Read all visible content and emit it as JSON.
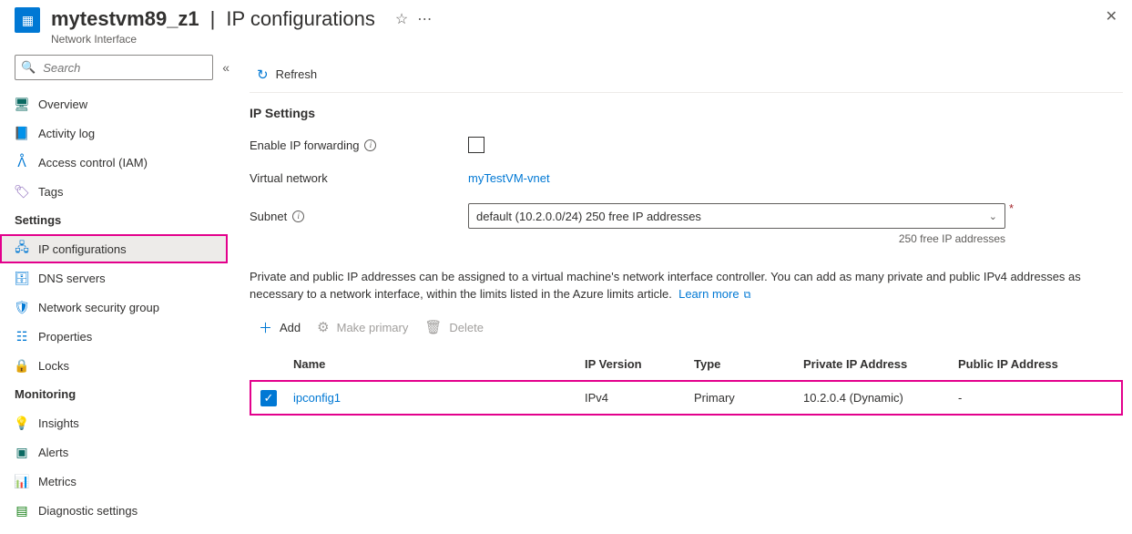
{
  "header": {
    "resource_name": "mytestvm89_z1",
    "page_name": "IP configurations",
    "resource_type": "Network Interface",
    "pin_tooltip": "Pin",
    "more_tooltip": "More",
    "close_tooltip": "Close"
  },
  "search": {
    "placeholder": "Search",
    "collapse_tooltip": "Collapse"
  },
  "nav": {
    "top": [
      {
        "label": "Overview"
      },
      {
        "label": "Activity log"
      },
      {
        "label": "Access control (IAM)"
      },
      {
        "label": "Tags"
      }
    ],
    "groups": [
      {
        "title": "Settings",
        "items": [
          {
            "label": "IP configurations",
            "selected": true
          },
          {
            "label": "DNS servers"
          },
          {
            "label": "Network security group"
          },
          {
            "label": "Properties"
          },
          {
            "label": "Locks"
          }
        ]
      },
      {
        "title": "Monitoring",
        "items": [
          {
            "label": "Insights"
          },
          {
            "label": "Alerts"
          },
          {
            "label": "Metrics"
          },
          {
            "label": "Diagnostic settings"
          }
        ]
      }
    ]
  },
  "commands": {
    "refresh": "Refresh"
  },
  "ip_settings": {
    "section_title": "IP Settings",
    "enable_forwarding_label": "Enable IP forwarding",
    "enable_forwarding_value": false,
    "vnet_label": "Virtual network",
    "vnet_value": "myTestVM-vnet",
    "subnet_label": "Subnet",
    "subnet_value": "default (10.2.0.0/24) 250 free IP addresses",
    "subnet_hint": "250 free IP addresses"
  },
  "description": {
    "text": "Private and public IP addresses can be assigned to a virtual machine's network interface controller. You can add as many private and public IPv4 addresses as necessary to a network interface, within the limits listed in the Azure limits article.",
    "learn_more": "Learn more"
  },
  "list_toolbar": {
    "add": "Add",
    "make_primary": "Make primary",
    "delete": "Delete"
  },
  "table": {
    "columns": {
      "name": "Name",
      "ip_version": "IP Version",
      "type": "Type",
      "private_ip": "Private IP Address",
      "public_ip": "Public IP Address"
    },
    "rows": [
      {
        "selected": true,
        "name": "ipconfig1",
        "ip_version": "IPv4",
        "type": "Primary",
        "private_ip": "10.2.0.4 (Dynamic)",
        "public_ip": "-"
      }
    ]
  }
}
